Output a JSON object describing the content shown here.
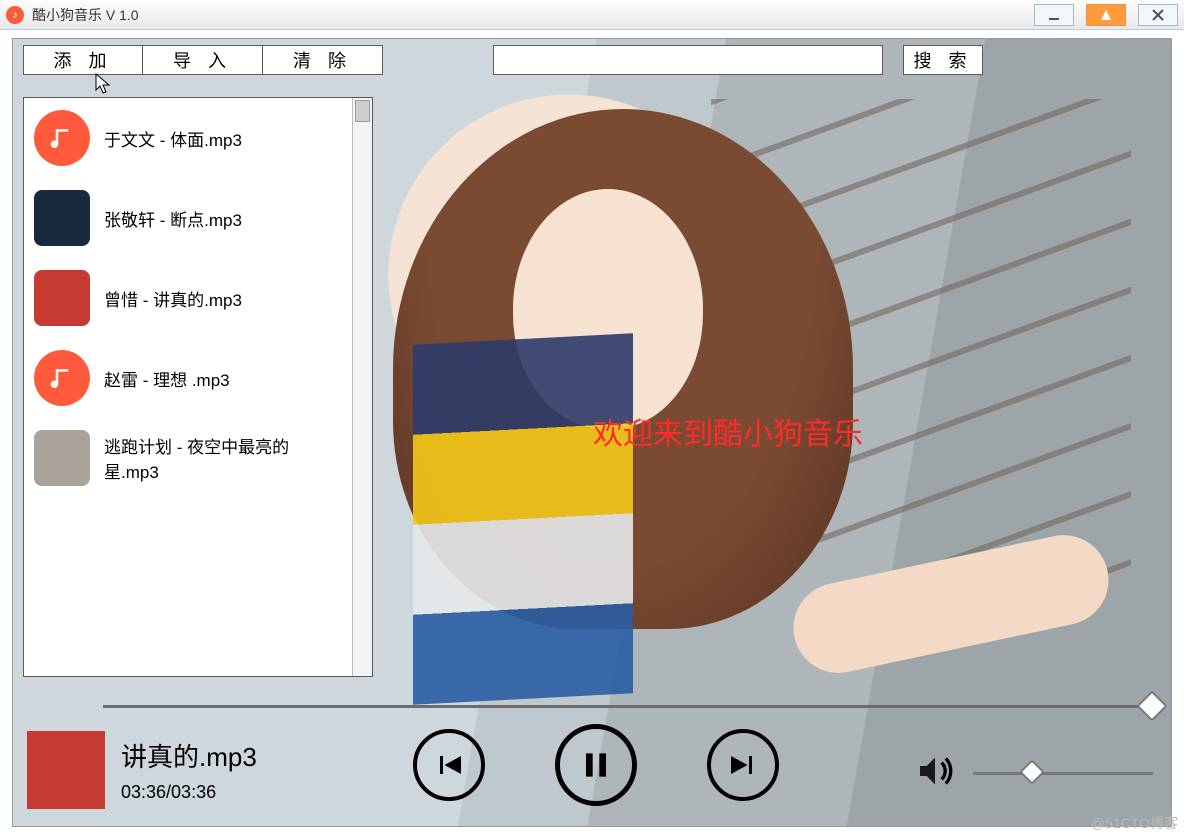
{
  "window": {
    "title": "酷小狗音乐  V 1.0"
  },
  "toolbar": {
    "add": "添 加",
    "import": "导 入",
    "clear": "清 除"
  },
  "search": {
    "value": "",
    "button": "搜 索"
  },
  "playlist": [
    {
      "label": "于文文 - 体面.mp3",
      "thumb": "round"
    },
    {
      "label": "张敬轩 - 断点.mp3",
      "thumb": "dark"
    },
    {
      "label": "曾惜 - 讲真的.mp3",
      "thumb": "red"
    },
    {
      "label": "赵雷 - 理想 .mp3",
      "thumb": "round"
    },
    {
      "label": "逃跑计划 - 夜空中最亮的星.mp3",
      "thumb": "grey"
    }
  ],
  "welcome": "欢迎来到酷小狗音乐",
  "now_playing": {
    "title": "讲真的.mp3",
    "time": "03:36/03:36"
  },
  "watermark": "@51CTO博客"
}
